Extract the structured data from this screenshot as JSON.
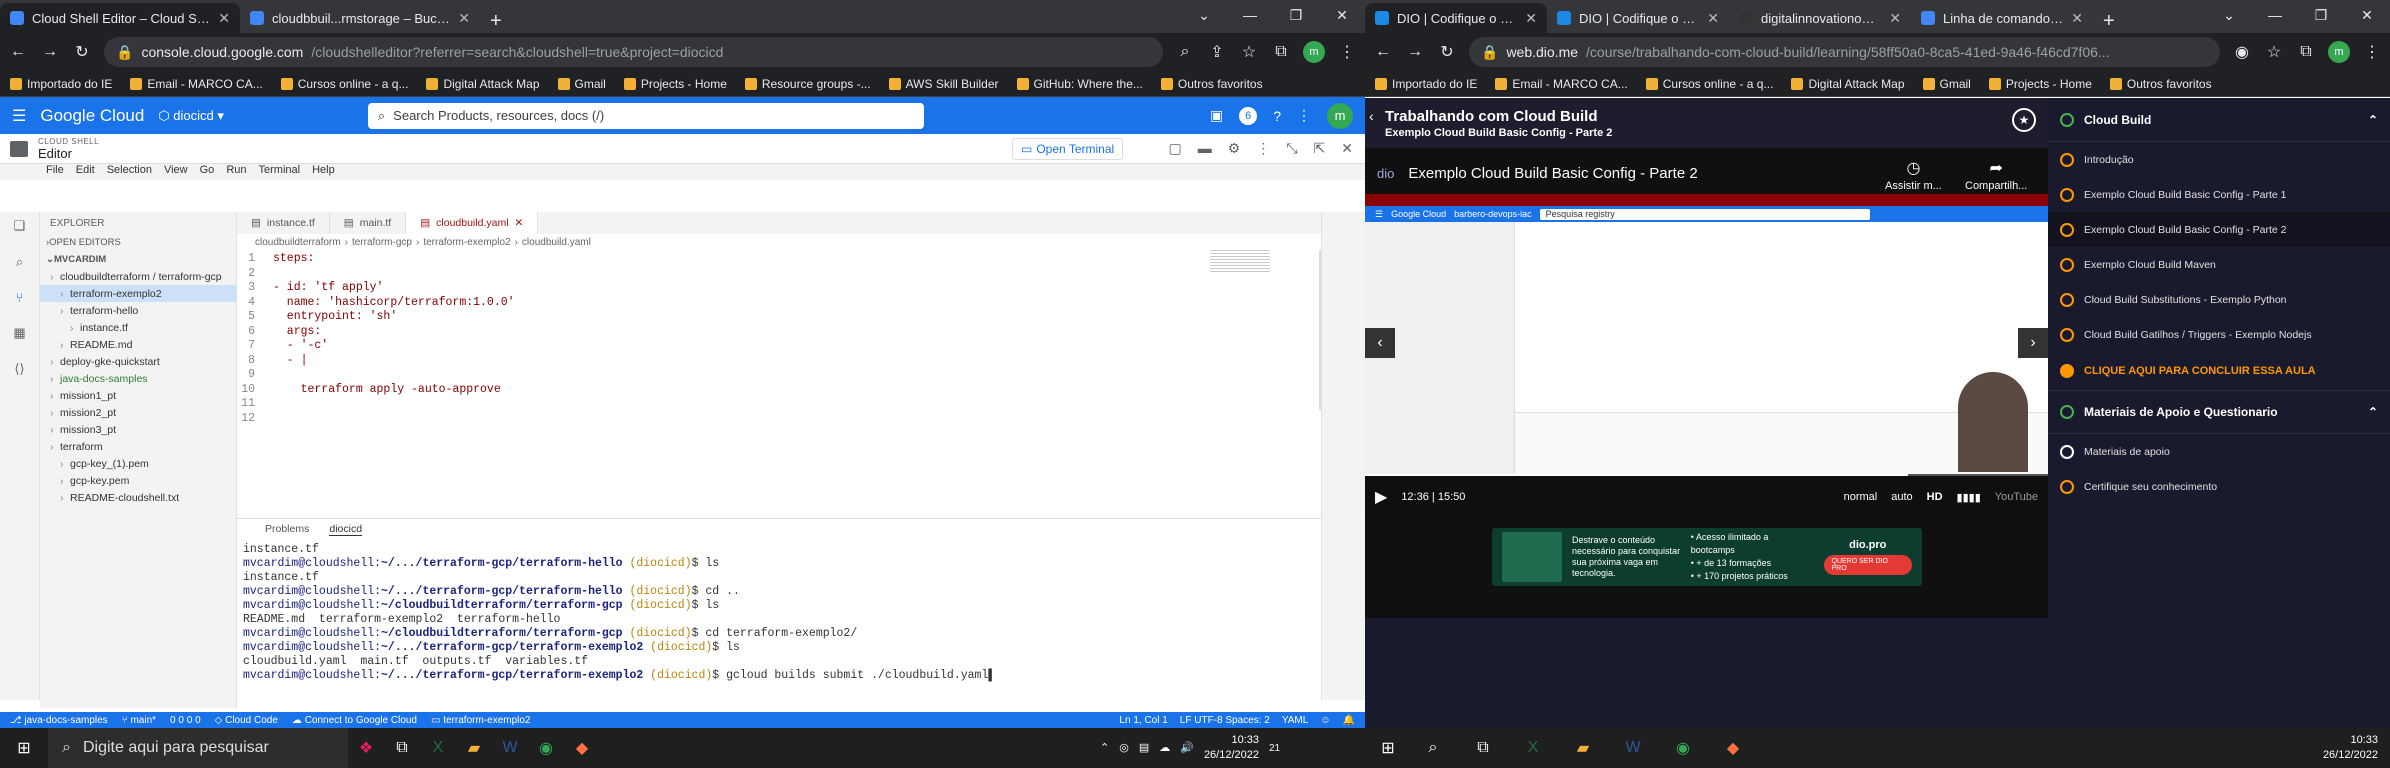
{
  "left_window": {
    "tabs": [
      {
        "title": "Cloud Shell Editor – Cloud Shell E",
        "active": true,
        "color": "#4285f4"
      },
      {
        "title": "cloudbbuil...rmstorage – Bucket",
        "active": false,
        "color": "#4285f4"
      }
    ],
    "url_host": "console.cloud.google.com",
    "url_path": "/cloudshelleditor?referrer=search&cloudshell=true&project=diocicd",
    "bookmarks": [
      "Importado do IE",
      "Email - MARCO CA...",
      "Cursos online - a q...",
      "Digital Attack Map",
      "Gmail",
      "Projects - Home",
      "Resource groups -...",
      "AWS Skill Builder",
      "GitHub: Where the...",
      "Outros favoritos"
    ],
    "console": {
      "product": "Google Cloud",
      "project": "diocicd",
      "search_placeholder": "Search  Products, resources, docs (/)",
      "avatar_letter": "m",
      "notif_count": "6"
    },
    "cloudshell": {
      "label": "CLOUD SHELL",
      "title": "Editor",
      "open_terminal": "Open Terminal"
    },
    "menu": [
      "File",
      "Edit",
      "Selection",
      "View",
      "Go",
      "Run",
      "Terminal",
      "Help"
    ],
    "explorer": {
      "header": "EXPLORER",
      "open_editors": "OPEN EDITORS",
      "workspace": "MVCARDIM",
      "items": [
        {
          "label": "cloudbuildterraform / terraform-gcp",
          "indent": 1,
          "selected": false,
          "green": false
        },
        {
          "label": "terraform-exemplo2",
          "indent": 2,
          "selected": true,
          "green": false
        },
        {
          "label": "terraform-hello",
          "indent": 2,
          "selected": false,
          "green": false
        },
        {
          "label": "instance.tf",
          "indent": 3,
          "selected": false,
          "green": false
        },
        {
          "label": "README.md",
          "indent": 2,
          "selected": false,
          "green": false
        },
        {
          "label": "deploy-gke-quickstart",
          "indent": 1,
          "selected": false,
          "green": false
        },
        {
          "label": "java-docs-samples",
          "indent": 1,
          "selected": false,
          "green": true
        },
        {
          "label": "mission1_pt",
          "indent": 1,
          "selected": false,
          "green": false
        },
        {
          "label": "mission2_pt",
          "indent": 1,
          "selected": false,
          "green": false
        },
        {
          "label": "mission3_pt",
          "indent": 1,
          "selected": false,
          "green": false
        },
        {
          "label": "terraform",
          "indent": 1,
          "selected": false,
          "green": false
        },
        {
          "label": "gcp-key_(1).pem",
          "indent": 2,
          "selected": false,
          "green": false
        },
        {
          "label": "gcp-key.pem",
          "indent": 2,
          "selected": false,
          "green": false
        },
        {
          "label": "README-cloudshell.txt",
          "indent": 2,
          "selected": false,
          "green": false
        }
      ]
    },
    "editor_tabs": [
      {
        "label": "instance.tf",
        "active": false
      },
      {
        "label": "main.tf",
        "active": false
      },
      {
        "label": "cloudbuild.yaml",
        "active": true
      }
    ],
    "breadcrumbs": [
      "cloudbuildterraform",
      "terraform-gcp",
      "terraform-exemplo2",
      "cloudbuild.yaml"
    ],
    "code_lines": [
      {
        "n": "1",
        "text": "steps:"
      },
      {
        "n": "2",
        "text": ""
      },
      {
        "n": "3",
        "text": "- id: 'tf apply'"
      },
      {
        "n": "4",
        "text": "  name: 'hashicorp/terraform:1.0.0'"
      },
      {
        "n": "5",
        "text": "  entrypoint: 'sh'"
      },
      {
        "n": "6",
        "text": "  args:"
      },
      {
        "n": "7",
        "text": "  - '-c'"
      },
      {
        "n": "8",
        "text": "  - |"
      },
      {
        "n": "9",
        "text": ""
      },
      {
        "n": "10",
        "text": "    terraform apply -auto-approve"
      },
      {
        "n": "11",
        "text": ""
      },
      {
        "n": "12",
        "text": ""
      }
    ],
    "terminal_tabs": [
      "Problems",
      "diocicd"
    ],
    "terminal_lines": [
      {
        "prompt": "",
        "path": "",
        "proj": "",
        "cmd": "instance.tf"
      },
      {
        "prompt": "mvcardim@cloudshell:",
        "path": "~/.../terraform-gcp/terraform-hello",
        "proj": " (diocicd)",
        "cmd": "$ ls"
      },
      {
        "prompt": "",
        "path": "",
        "proj": "",
        "cmd": "instance.tf"
      },
      {
        "prompt": "mvcardim@cloudshell:",
        "path": "~/.../terraform-gcp/terraform-hello",
        "proj": " (diocicd)",
        "cmd": "$ cd .."
      },
      {
        "prompt": "mvcardim@cloudshell:",
        "path": "~/cloudbuildterraform/terraform-gcp",
        "proj": " (diocicd)",
        "cmd": "$ ls"
      },
      {
        "prompt": "",
        "path": "",
        "proj": "",
        "cmd": "README.md  terraform-exemplo2  terraform-hello"
      },
      {
        "prompt": "mvcardim@cloudshell:",
        "path": "~/cloudbuildterraform/terraform-gcp",
        "proj": " (diocicd)",
        "cmd": "$ cd terraform-exemplo2/"
      },
      {
        "prompt": "mvcardim@cloudshell:",
        "path": "~/.../terraform-gcp/terraform-exemplo2",
        "proj": " (diocicd)",
        "cmd": "$ ls"
      },
      {
        "prompt": "",
        "path": "",
        "proj": "",
        "cmd": "cloudbuild.yaml  main.tf  outputs.tf  variables.tf"
      },
      {
        "prompt": "mvcardim@cloudshell:",
        "path": "~/.../terraform-gcp/terraform-exemplo2",
        "proj": " (diocicd)",
        "cmd": "$ gcloud builds submit ./cloudbuild.yaml"
      }
    ],
    "statusbar": {
      "branch": "java-docs-samples",
      "git": "main*",
      "problems": "0 0 0 0",
      "cloud_code": "Cloud Code",
      "connect": "Connect to Google Cloud",
      "folder": "terraform-exemplo2",
      "position": "Ln 1, Col 1",
      "indent": "LF  UTF-8  Spaces: 2",
      "lang": "YAML"
    }
  },
  "right_window": {
    "tabs": [
      {
        "title": "DIO | Codifique o seu f",
        "active": true,
        "color": "#1e88e5"
      },
      {
        "title": "DIO | Codifique o seu f",
        "active": false,
        "color": "#1e88e5"
      },
      {
        "title": "digitalinnovationone/tr",
        "active": false,
        "color": "#333333"
      },
      {
        "title": "Linha de comando gclo",
        "active": false,
        "color": "#4285f4"
      }
    ],
    "url_host": "web.dio.me",
    "url_path": "/course/trabalhando-com-cloud-build/learning/58ff50a0-8ca5-41ed-9a46-f46cd7f06...",
    "bookmarks": [
      "Importado do IE",
      "Email - MARCO CA...",
      "Cursos online - a q...",
      "Digital Attack Map",
      "Gmail",
      "Projects - Home",
      "Outros favoritos"
    ],
    "course": {
      "title": "Trabalhando com Cloud Build",
      "subtitle": "Exemplo Cloud Build Basic Config - Parte 2"
    },
    "video": {
      "title": "Exemplo Cloud Build Basic Config - Parte 2",
      "watch_later": "Assistir m...",
      "share": "Compartilh...",
      "time_current": "12:36",
      "time_total": "15:50",
      "progress": 0.7956,
      "speed": "normal",
      "quality": "auto",
      "hd": "HD",
      "brand": "YouTube",
      "inner_project": "barbero-devops-iac",
      "inner_search": "Pesquisa  registry"
    },
    "banner": {
      "left": "Destrave o conteúdo necessário para conquistar sua próxima vaga em tecnologia.",
      "items": [
        "Acesso ilimitado a bootcamps",
        "+ de 13 formações",
        "+ 170 projetos práticos"
      ],
      "brand": "dio.pro",
      "cta": "QUERO SER DIO PRO"
    },
    "sidebar": {
      "section1": "Cloud Build",
      "lessons": [
        {
          "label": "Introdução",
          "current": false
        },
        {
          "label": "Exemplo Cloud Build Basic Config - Parte 1",
          "current": false
        },
        {
          "label": "Exemplo Cloud Build Basic Config - Parte 2",
          "current": true
        },
        {
          "label": "Exemplo Cloud Build Maven",
          "current": false
        },
        {
          "label": "Cloud Build Substitutions - Exemplo Python",
          "current": false
        },
        {
          "label": "Cloud Build Gatilhos / Triggers - Exemplo Nodejs",
          "current": false
        }
      ],
      "conclude": "CLIQUE AQUI PARA CONCLUIR ESSA AULA",
      "section2": "Materiais de Apoio e Questionario",
      "materials": [
        "Materiais de apoio",
        "Certifique seu conhecimento"
      ]
    }
  },
  "taskbar": {
    "search_placeholder": "Digite aqui para pesquisar",
    "time_left": "10:33",
    "date_left": "26/12/2022",
    "time_right": "10:33",
    "date_right": "26/12/2022",
    "notif_left": "21"
  },
  "colors": {
    "gc_blue": "#1a73e8",
    "dio_bg": "#1a1a2e",
    "dio_orange": "#ff9800",
    "dio_green": "#4caf50"
  }
}
